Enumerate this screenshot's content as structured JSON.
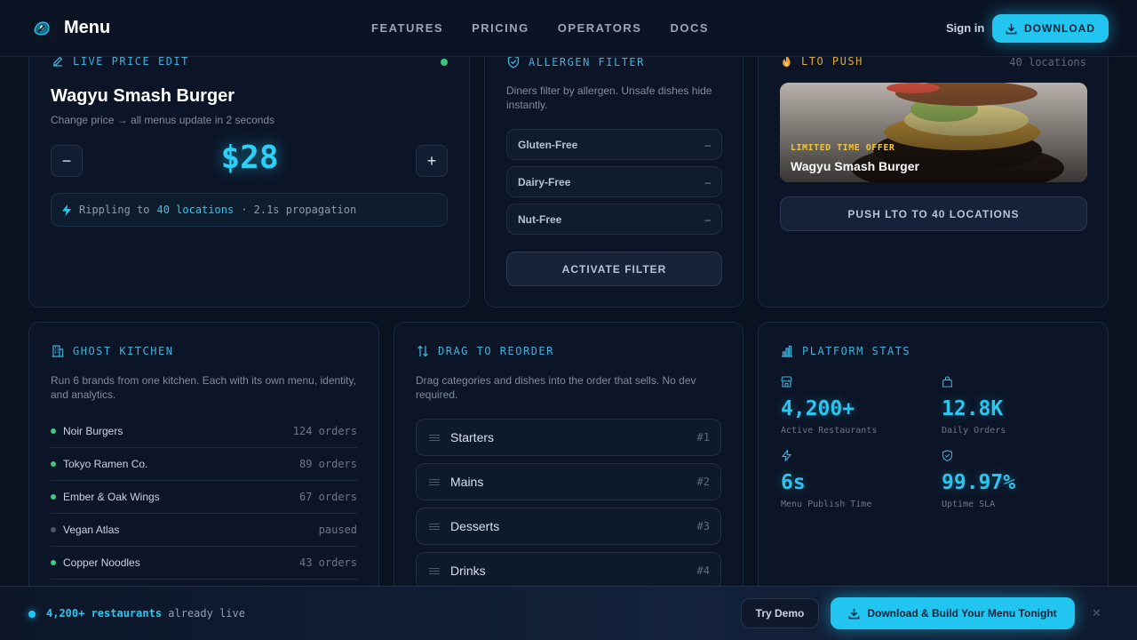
{
  "nav": {
    "brand": "Menu",
    "links": [
      "FEATURES",
      "PRICING",
      "OPERATORS",
      "DOCS"
    ],
    "signin": "Sign in",
    "download": "DOWNLOAD"
  },
  "price_edit": {
    "label": "LIVE PRICE EDIT",
    "item": "Wagyu Smash Burger",
    "desc": "Change price → all menus update in 2 seconds",
    "minus": "−",
    "plus": "+",
    "price": "$28",
    "ripple_prefix": "Rippling to",
    "ripple_locations": "40 locations",
    "ripple_suffix": "· 2.1s propagation"
  },
  "allergen": {
    "label": "ALLERGEN FILTER",
    "desc": "Diners filter by allergen. Unsafe dishes hide instantly.",
    "rows": [
      {
        "name": "Gluten-Free",
        "state": "–"
      },
      {
        "name": "Dairy-Free",
        "state": "–"
      },
      {
        "name": "Nut-Free",
        "state": "–"
      }
    ],
    "button": "ACTIVATE FILTER"
  },
  "lto": {
    "label": "LTO PUSH",
    "count": "40 locations",
    "tag": "LIMITED TIME OFFER",
    "item": "Wagyu Smash Burger",
    "button": "PUSH LTO TO 40 LOCATIONS"
  },
  "ghost": {
    "label": "GHOST KITCHEN",
    "desc": "Run 6 brands from one kitchen. Each with its own menu, identity, and analytics.",
    "brands": [
      {
        "name": "Noir Burgers",
        "orders": "124 orders",
        "active": true
      },
      {
        "name": "Tokyo Ramen Co.",
        "orders": "89 orders",
        "active": true
      },
      {
        "name": "Ember & Oak Wings",
        "orders": "67 orders",
        "active": true
      },
      {
        "name": "Vegan Atlas",
        "orders": "paused",
        "active": false
      },
      {
        "name": "Copper Noodles",
        "orders": "43 orders",
        "active": true
      }
    ]
  },
  "reorder": {
    "label": "DRAG TO REORDER",
    "desc": "Drag categories and dishes into the order that sells. No dev required.",
    "items": [
      {
        "name": "Starters",
        "num": "#1"
      },
      {
        "name": "Mains",
        "num": "#2"
      },
      {
        "name": "Desserts",
        "num": "#3"
      },
      {
        "name": "Drinks",
        "num": "#4"
      }
    ]
  },
  "stats": {
    "label": "PLATFORM STATS",
    "items": [
      {
        "value": "4,200+",
        "label": "Active Restaurants",
        "icon": "storefront-icon"
      },
      {
        "value": "12.8K",
        "label": "Daily Orders",
        "icon": "bag-icon"
      },
      {
        "value": "6s",
        "label": "Menu Publish Time",
        "icon": "bolt-icon"
      },
      {
        "value": "99.97%",
        "label": "Uptime SLA",
        "icon": "shield-check-icon"
      }
    ]
  },
  "bottom": {
    "highlight": "4,200+ restaurants",
    "rest": "already live",
    "try": "Try Demo",
    "build": "Download & Build Your Menu Tonight",
    "close": "✕"
  },
  "colors": {
    "accent": "#22c5f0",
    "background": "#0a1120",
    "live": "#34c87a",
    "lto": "#f2c53d"
  }
}
